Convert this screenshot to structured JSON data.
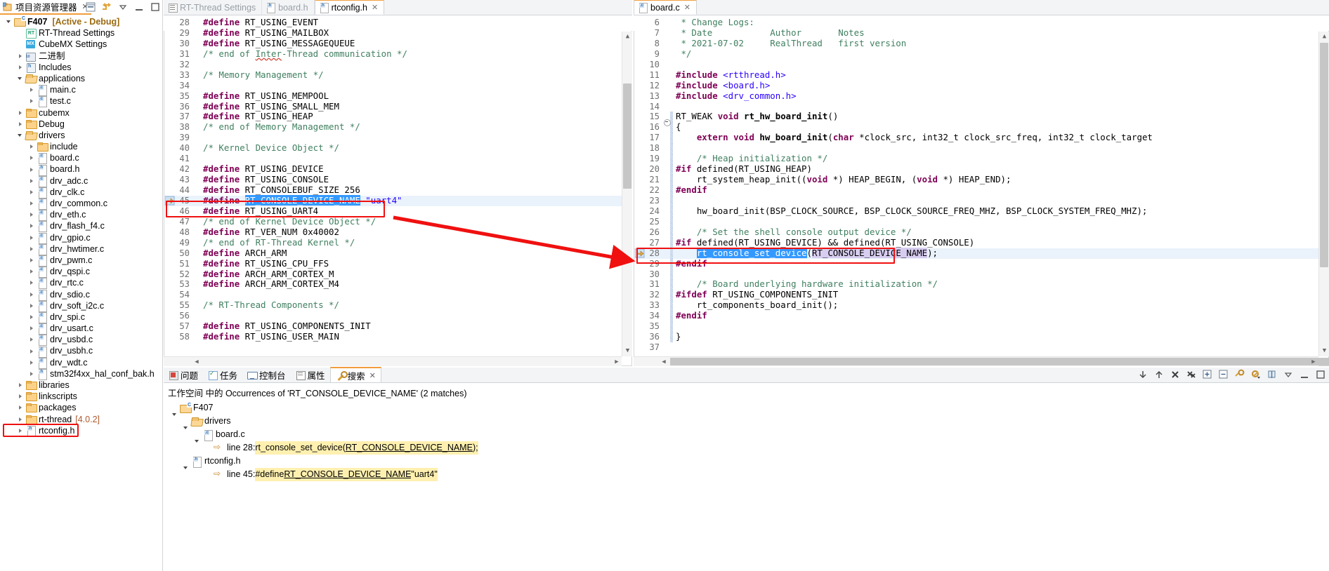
{
  "explorer": {
    "tab_label": "项目资源管理器",
    "close_glyph": "✕",
    "toolbar": [
      "collapse-all-icon",
      "link-with-editor-icon",
      "view-menu-icon",
      "minimize-icon",
      "maximize-icon"
    ],
    "tree": [
      {
        "indent": 0,
        "arrow": "open",
        "icon": "project-icon",
        "label": "F407",
        "bold": true,
        "suffix": "[Active - Debug]"
      },
      {
        "indent": 1,
        "arrow": "none",
        "icon": "rt-thread-icon",
        "label": "RT-Thread Settings"
      },
      {
        "indent": 1,
        "arrow": "none",
        "icon": "cubemx-icon",
        "label": "CubeMX Settings"
      },
      {
        "indent": 1,
        "arrow": "closed",
        "icon": "binaries-icon",
        "label": "二进制"
      },
      {
        "indent": 1,
        "arrow": "closed",
        "icon": "includes-icon",
        "label": "Includes"
      },
      {
        "indent": 1,
        "arrow": "open",
        "icon": "folder-open-icon",
        "label": "applications"
      },
      {
        "indent": 2,
        "arrow": "closed",
        "icon": "c-file-icon",
        "label": "main.c"
      },
      {
        "indent": 2,
        "arrow": "closed",
        "icon": "c-file-icon",
        "label": "test.c"
      },
      {
        "indent": 1,
        "arrow": "closed",
        "icon": "folder-icon",
        "label": "cubemx"
      },
      {
        "indent": 1,
        "arrow": "closed",
        "icon": "folder-icon",
        "label": "Debug"
      },
      {
        "indent": 1,
        "arrow": "open",
        "icon": "folder-open-icon",
        "label": "drivers"
      },
      {
        "indent": 2,
        "arrow": "closed",
        "icon": "folder-icon",
        "label": "include"
      },
      {
        "indent": 2,
        "arrow": "closed",
        "icon": "c-file-icon",
        "label": "board.c"
      },
      {
        "indent": 2,
        "arrow": "closed",
        "icon": "h-file-icon",
        "label": "board.h"
      },
      {
        "indent": 2,
        "arrow": "closed",
        "icon": "c-file-icon",
        "label": "drv_adc.c"
      },
      {
        "indent": 2,
        "arrow": "closed",
        "icon": "c-file-icon",
        "label": "drv_clk.c"
      },
      {
        "indent": 2,
        "arrow": "closed",
        "icon": "c-file-icon",
        "label": "drv_common.c"
      },
      {
        "indent": 2,
        "arrow": "closed",
        "icon": "c-file-icon",
        "label": "drv_eth.c"
      },
      {
        "indent": 2,
        "arrow": "closed",
        "icon": "c-file-icon",
        "label": "drv_flash_f4.c"
      },
      {
        "indent": 2,
        "arrow": "closed",
        "icon": "c-file-icon",
        "label": "drv_gpio.c"
      },
      {
        "indent": 2,
        "arrow": "closed",
        "icon": "c-file-icon",
        "label": "drv_hwtimer.c"
      },
      {
        "indent": 2,
        "arrow": "closed",
        "icon": "c-file-icon",
        "label": "drv_pwm.c"
      },
      {
        "indent": 2,
        "arrow": "closed",
        "icon": "c-file-icon",
        "label": "drv_qspi.c"
      },
      {
        "indent": 2,
        "arrow": "closed",
        "icon": "c-file-icon",
        "label": "drv_rtc.c"
      },
      {
        "indent": 2,
        "arrow": "closed",
        "icon": "c-file-icon",
        "label": "drv_sdio.c"
      },
      {
        "indent": 2,
        "arrow": "closed",
        "icon": "c-file-icon",
        "label": "drv_soft_i2c.c"
      },
      {
        "indent": 2,
        "arrow": "closed",
        "icon": "c-file-icon",
        "label": "drv_spi.c"
      },
      {
        "indent": 2,
        "arrow": "closed",
        "icon": "c-file-icon",
        "label": "drv_usart.c"
      },
      {
        "indent": 2,
        "arrow": "closed",
        "icon": "c-file-icon",
        "label": "drv_usbd.c"
      },
      {
        "indent": 2,
        "arrow": "closed",
        "icon": "c-file-icon",
        "label": "drv_usbh.c"
      },
      {
        "indent": 2,
        "arrow": "closed",
        "icon": "c-file-icon",
        "label": "drv_wdt.c"
      },
      {
        "indent": 2,
        "arrow": "closed",
        "icon": "h-file-icon",
        "label": "stm32f4xx_hal_conf_bak.h"
      },
      {
        "indent": 1,
        "arrow": "closed",
        "icon": "folder-icon",
        "label": "libraries"
      },
      {
        "indent": 1,
        "arrow": "closed",
        "icon": "folder-icon",
        "label": "linkscripts"
      },
      {
        "indent": 1,
        "arrow": "closed",
        "icon": "folder-icon",
        "label": "packages"
      },
      {
        "indent": 1,
        "arrow": "closed",
        "icon": "folder-icon",
        "label": "rt-thread",
        "version": "[4.0.2]"
      },
      {
        "indent": 1,
        "arrow": "closed",
        "icon": "h-file-icon",
        "label": "rtconfig.h",
        "highlighted": true
      }
    ]
  },
  "editor_left": {
    "tabs": [
      {
        "label": "RT-Thread Settings",
        "icon": "settings-icon",
        "active": false
      },
      {
        "label": "board.h",
        "icon": "h-file-icon",
        "active": false
      },
      {
        "label": "rtconfig.h",
        "icon": "h-file-icon",
        "active": true,
        "close_glyph": "✕"
      }
    ],
    "first_line": 28,
    "lines": [
      {
        "n": 28,
        "html": "<span class=\"pp\">#define</span> RT_USING_EVENT"
      },
      {
        "n": 29,
        "html": "<span class=\"pp\">#define</span> RT_USING_MAILBOX"
      },
      {
        "n": 30,
        "html": "<span class=\"pp\">#define</span> RT_USING_MESSAGEQUEUE"
      },
      {
        "n": 31,
        "html": "<span class=\"cm\">/* end of <span class=\"sq\">Inter</span>-Thread communication */</span>"
      },
      {
        "n": 32,
        "html": ""
      },
      {
        "n": 33,
        "html": "<span class=\"cm\">/* Memory Management */</span>"
      },
      {
        "n": 34,
        "html": ""
      },
      {
        "n": 35,
        "html": "<span class=\"pp\">#define</span> RT_USING_MEMPOOL"
      },
      {
        "n": 36,
        "html": "<span class=\"pp\">#define</span> RT_USING_SMALL_MEM"
      },
      {
        "n": 37,
        "html": "<span class=\"pp\">#define</span> RT_USING_HEAP"
      },
      {
        "n": 38,
        "html": "<span class=\"cm\">/* end of Memory Management */</span>"
      },
      {
        "n": 39,
        "html": ""
      },
      {
        "n": 40,
        "html": "<span class=\"cm\">/* Kernel Device Object */</span>"
      },
      {
        "n": 41,
        "html": ""
      },
      {
        "n": 42,
        "html": "<span class=\"pp\">#define</span> RT_USING_DEVICE"
      },
      {
        "n": 43,
        "html": "<span class=\"pp\">#define</span> RT_USING_CONSOLE"
      },
      {
        "n": 44,
        "html": "<span class=\"pp\">#define</span> RT_CONSOLEBUF_SIZE 256"
      },
      {
        "n": 45,
        "html": "<span class=\"pp\">#define</span> <span class=\"sel\">RT_CONSOLE_DEVICE_NAME</span> <span class=\"st\">\"uart4\"</span>",
        "highlight": true,
        "marker": "search-match-icon"
      },
      {
        "n": 46,
        "html": "<span class=\"pp\">#define</span> RT_USING_UART4"
      },
      {
        "n": 47,
        "html": "<span class=\"cm\">/* end of Kernel Device Object */</span>"
      },
      {
        "n": 48,
        "html": "<span class=\"pp\">#define</span> RT_VER_NUM 0x40002"
      },
      {
        "n": 49,
        "html": "<span class=\"cm\">/* end of RT-Thread Kernel */</span>"
      },
      {
        "n": 50,
        "html": "<span class=\"pp\">#define</span> ARCH_ARM"
      },
      {
        "n": 51,
        "html": "<span class=\"pp\">#define</span> RT_USING_CPU_FFS"
      },
      {
        "n": 52,
        "html": "<span class=\"pp\">#define</span> ARCH_ARM_CORTEX_M"
      },
      {
        "n": 53,
        "html": "<span class=\"pp\">#define</span> ARCH_ARM_CORTEX_M4"
      },
      {
        "n": 54,
        "html": ""
      },
      {
        "n": 55,
        "html": "<span class=\"cm\">/* RT-Thread Components */</span>"
      },
      {
        "n": 56,
        "html": ""
      },
      {
        "n": 57,
        "html": "<span class=\"pp\">#define</span> RT_USING_COMPONENTS_INIT"
      },
      {
        "n": 58,
        "html": "<span class=\"pp\">#define</span> RT_USING_USER_MAIN"
      }
    ]
  },
  "editor_right": {
    "tabs": [
      {
        "label": "board.c",
        "icon": "c-file-icon",
        "active": true,
        "close_glyph": "✕"
      }
    ],
    "lines": [
      {
        "n": 6,
        "html": "<span class=\"cm\"> * Change Logs:</span>"
      },
      {
        "n": 7,
        "html": "<span class=\"cm\"> * Date           Author       Notes</span>"
      },
      {
        "n": 8,
        "html": "<span class=\"cm\"> * 2021-07-02     RealThread   first version</span>"
      },
      {
        "n": 9,
        "html": "<span class=\"cm\"> */</span>"
      },
      {
        "n": 10,
        "html": ""
      },
      {
        "n": 11,
        "html": "<span class=\"pp\">#include</span> <span class=\"inc\">&lt;rtthread.h&gt;</span>"
      },
      {
        "n": 12,
        "html": "<span class=\"pp\">#include</span> <span class=\"inc\">&lt;board.h&gt;</span>"
      },
      {
        "n": 13,
        "html": "<span class=\"pp\">#include</span> <span class=\"inc\">&lt;drv_common.h&gt;</span>"
      },
      {
        "n": 14,
        "html": ""
      },
      {
        "n": 15,
        "html": "RT_WEAK <span class=\"kw\">void</span> <span class=\"fn\">rt_hw_board_init</span>()",
        "fold": true,
        "bar": true
      },
      {
        "n": 16,
        "html": "{",
        "bar": true
      },
      {
        "n": 17,
        "html": "    <span class=\"kw\">extern</span> <span class=\"kw\">void</span> <span class=\"fn\">hw_board_init</span>(<span class=\"kw\">char</span> *clock_src, int32_t clock_src_freq, int32_t clock_target",
        "bar": true
      },
      {
        "n": 18,
        "html": "",
        "bar": true
      },
      {
        "n": 19,
        "html": "    <span class=\"cm\">/* Heap initialization */</span>",
        "bar": true
      },
      {
        "n": 20,
        "html": "<span class=\"pp\">#if</span> defined(RT_USING_HEAP)",
        "bar": true
      },
      {
        "n": 21,
        "html": "    rt_system_heap_init((<span class=\"kw\">void</span> *) HEAP_BEGIN, (<span class=\"kw\">void</span> *) HEAP_END);",
        "bar": true
      },
      {
        "n": 22,
        "html": "<span class=\"pp\">#endif</span>",
        "bar": true
      },
      {
        "n": 23,
        "html": "",
        "bar": true
      },
      {
        "n": 24,
        "html": "    hw_board_init(BSP_CLOCK_SOURCE, BSP_CLOCK_SOURCE_FREQ_MHZ, BSP_CLOCK_SYSTEM_FREQ_MHZ);",
        "bar": true
      },
      {
        "n": 25,
        "html": "",
        "bar": true
      },
      {
        "n": 26,
        "html": "    <span class=\"cm\">/* Set the shell console output device */</span>",
        "bar": true
      },
      {
        "n": 27,
        "html": "<span class=\"pp\">#if</span> defined(RT_USING_DEVICE) &amp;&amp; defined(RT_USING_CONSOLE)",
        "bar": true
      },
      {
        "n": 28,
        "html": "    <span class=\"sel2\">rt_console_set_device</span>(<span class=\"selv\">RT_CONSOLE_DEVICE_NAME</span>);",
        "highlight": true,
        "marker": "search-match-icon",
        "bar": true
      },
      {
        "n": 29,
        "html": "<span class=\"pp\">#endif</span>",
        "bar": true
      },
      {
        "n": 30,
        "html": "",
        "bar": true
      },
      {
        "n": 31,
        "html": "    <span class=\"cm\">/* Board underlying hardware initialization */</span>",
        "bar": true
      },
      {
        "n": 32,
        "html": "<span class=\"pp\">#ifdef</span> RT_USING_COMPONENTS_INIT",
        "bar": true
      },
      {
        "n": 33,
        "html": "    rt_components_board_init();",
        "bar": true
      },
      {
        "n": 34,
        "html": "<span class=\"pp\">#endif</span>",
        "bar": true
      },
      {
        "n": 35,
        "html": "",
        "bar": true
      },
      {
        "n": 36,
        "html": "}",
        "bar": true
      },
      {
        "n": 37,
        "html": ""
      }
    ]
  },
  "bottom_panel": {
    "tabs": [
      {
        "label": "问题",
        "icon": "problems-icon",
        "active": false
      },
      {
        "label": "任务",
        "icon": "tasks-icon",
        "active": false
      },
      {
        "label": "控制台",
        "icon": "console-icon",
        "active": false
      },
      {
        "label": "属性",
        "icon": "properties-icon",
        "active": false
      },
      {
        "label": "搜索",
        "icon": "search-icon",
        "active": true,
        "close_glyph": "✕"
      }
    ],
    "toolbar": [
      "next-match-icon",
      "previous-match-icon",
      "remove-selected-matches-icon",
      "remove-all-matches-icon",
      "expand-all-icon",
      "collapse-all-icon",
      "run-current-search-icon",
      "show-previous-searches-icon",
      "pin-search-icon",
      "view-menu-icon",
      "minimize-icon",
      "maximize-icon"
    ],
    "description": "工作空间 中的 Occurrences of 'RT_CONSOLE_DEVICE_NAME' (2 matches)",
    "results": [
      {
        "indent": 0,
        "arrow": "open",
        "icon": "project-icon",
        "label": "F407"
      },
      {
        "indent": 1,
        "arrow": "open",
        "icon": "folder-open-icon",
        "label": "drivers"
      },
      {
        "indent": 2,
        "arrow": "open",
        "icon": "c-file-icon",
        "label": "board.c"
      },
      {
        "indent": 3,
        "arrow": "none",
        "icon": "match-icon",
        "prefix": "line 28: ",
        "code_pre": "rt_console_set_device(",
        "code_match": "RT_CONSOLE_DEVICE_NAME",
        "code_post": ");"
      },
      {
        "indent": 1,
        "arrow": "open",
        "icon": "h-file-icon",
        "label": "rtconfig.h"
      },
      {
        "indent": 3,
        "arrow": "none",
        "icon": "match-icon",
        "prefix": "line 45: ",
        "code_pre": "#define ",
        "code_match": "RT_CONSOLE_DEVICE_NAME",
        "code_post": " \"uart4\""
      }
    ]
  },
  "annotations": {
    "accent_red": "#f01010",
    "selection_blue": "#3399ff",
    "highlight_row": "#eaf2fb",
    "tab_accent": "#f19d3c"
  }
}
